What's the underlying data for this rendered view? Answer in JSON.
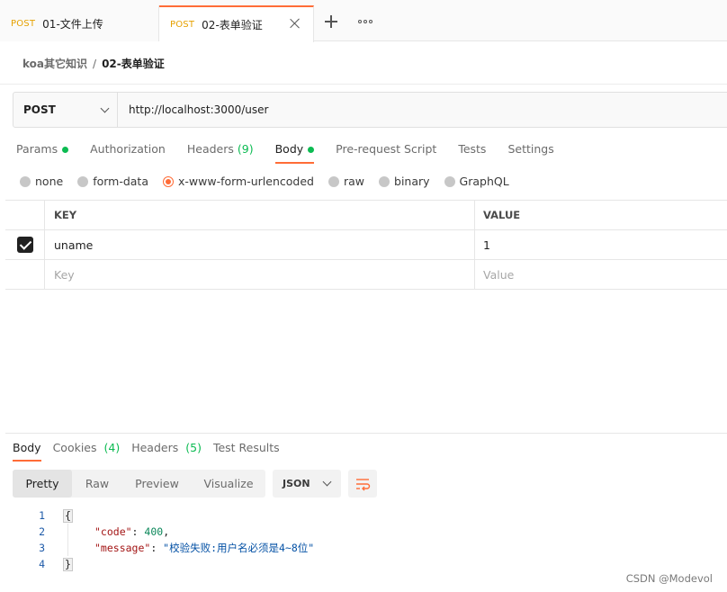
{
  "tabs": [
    {
      "method": "POST",
      "name": "01-文件上传"
    },
    {
      "method": "POST",
      "name": "02-表单验证"
    }
  ],
  "breadcrumb": {
    "parent": "koa其它知识",
    "separator": "/",
    "current": "02-表单验证"
  },
  "request": {
    "method": "POST",
    "url": "http://localhost:3000/user",
    "tabs": {
      "params": "Params",
      "authorization": "Authorization",
      "headers": "Headers",
      "headers_count": "(9)",
      "body": "Body",
      "prerequest": "Pre-request Script",
      "tests": "Tests",
      "settings": "Settings"
    }
  },
  "body_types": {
    "none": "none",
    "form_data": "form-data",
    "urlencoded": "x-www-form-urlencoded",
    "raw": "raw",
    "binary": "binary",
    "graphql": "GraphQL",
    "selected": "x-www-form-urlencoded"
  },
  "kv_table": {
    "headers": {
      "key": "KEY",
      "value": "VALUE"
    },
    "rows": [
      {
        "key": "uname",
        "value": "1",
        "checked": true
      }
    ],
    "placeholder": {
      "key": "Key",
      "value": "Value"
    }
  },
  "response": {
    "tabs": {
      "body": "Body",
      "cookies": "Cookies",
      "cookies_count": "(4)",
      "headers": "Headers",
      "headers_count": "(5)",
      "test_results": "Test Results"
    },
    "views": [
      "Pretty",
      "Raw",
      "Preview",
      "Visualize"
    ],
    "active_view": "Pretty",
    "format": "JSON",
    "lines": {
      "n1": "1",
      "n2": "2",
      "n3": "3",
      "n4": "4",
      "open": "{",
      "code_key": "\"code\"",
      "code_val": "400",
      "message_key": "\"message\"",
      "message_val": "\"校验失败:用户名必须是4~8位\"",
      "close": "}"
    }
  },
  "watermark": "CSDN @Modevol",
  "colors": {
    "accent": "#ff6c37",
    "green": "#0cbb52",
    "method": "#e6a100"
  }
}
